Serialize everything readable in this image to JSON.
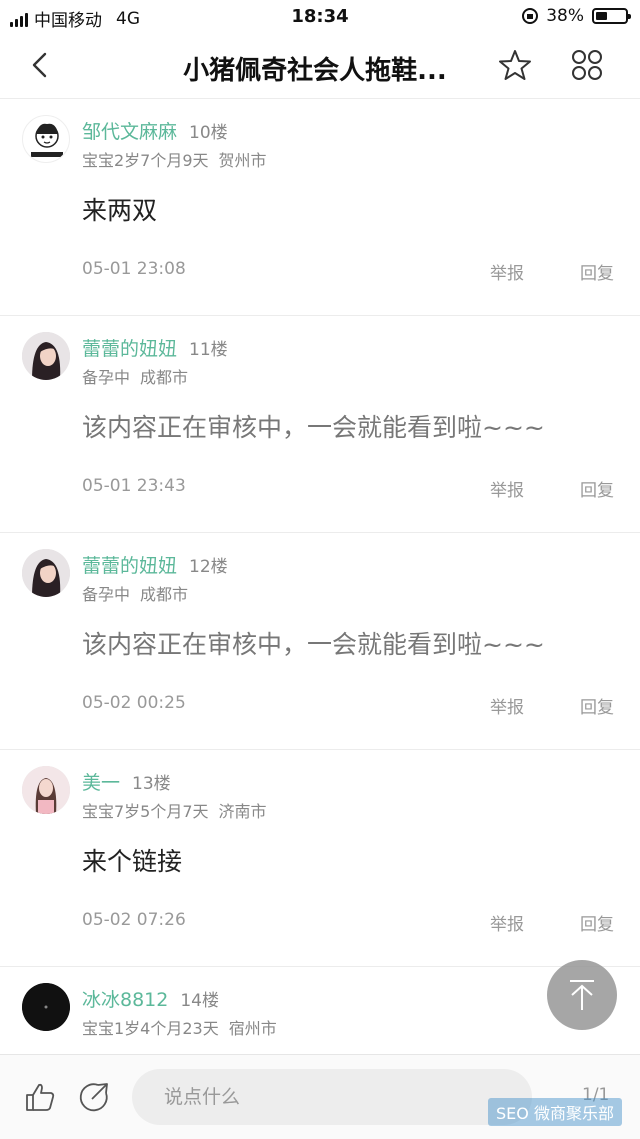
{
  "status_bar": {
    "carrier": "中国移动",
    "network": "4G",
    "time": "18:34",
    "battery": "38%",
    "battery_level": 0.38
  },
  "nav": {
    "title": "小猪佩奇社会人拖鞋..."
  },
  "posts": [
    {
      "username": "邹代文麻麻",
      "floor": "10楼",
      "meta": "宝宝2岁7个月9天",
      "location": "贺州市",
      "content": "来两双",
      "time": "05-01 23:08",
      "report": "举报",
      "reply": "回复"
    },
    {
      "username": "蕾蕾的妞妞",
      "floor": "11楼",
      "meta": "备孕中",
      "location": "成都市",
      "content": "该内容正在审核中，一会就能看到啦~~~",
      "time": "05-01 23:43",
      "report": "举报",
      "reply": "回复"
    },
    {
      "username": "蕾蕾的妞妞",
      "floor": "12楼",
      "meta": "备孕中",
      "location": "成都市",
      "content": "该内容正在审核中，一会就能看到啦~~~",
      "time": "05-02 00:25",
      "report": "举报",
      "reply": "回复"
    },
    {
      "username": "美一",
      "floor": "13楼",
      "meta": "宝宝7岁5个月7天",
      "location": "济南市",
      "content": "来个链接",
      "time": "05-02 07:26",
      "report": "举报",
      "reply": "回复"
    },
    {
      "username": "冰冰8812",
      "floor": "14楼",
      "meta": "宝宝1岁4个月23天",
      "location": "宿州市"
    }
  ],
  "bottom_bar": {
    "placeholder": "说点什么",
    "page": "1/1"
  },
  "watermark": "SEO 微商聚乐部",
  "colors": {
    "username": "#5cb89a",
    "muted": "#999999"
  }
}
